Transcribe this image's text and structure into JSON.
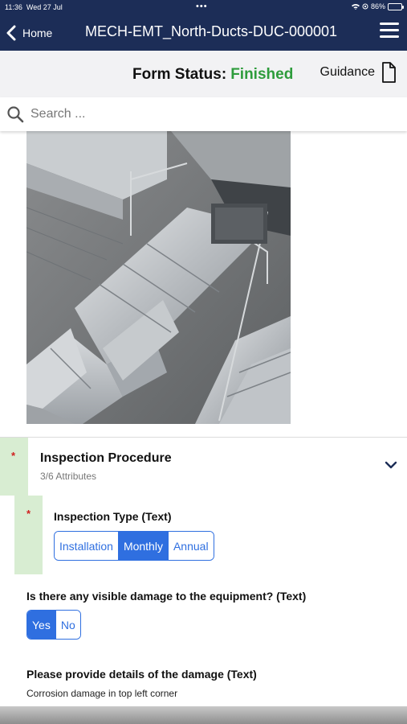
{
  "status_bar": {
    "time": "11:36",
    "date": "Wed 27 Jul",
    "dots": "•••",
    "battery_pct": "86%",
    "battery_level": 0.86
  },
  "nav": {
    "back_label": "Home",
    "title": "MECH-EMT_North-Ducts-DUC-000001"
  },
  "form_status": {
    "label": "Form Status:",
    "value": "Finished",
    "value_color": "#2e9c3c",
    "guidance_label": "Guidance"
  },
  "search": {
    "placeholder": "Search ..."
  },
  "section": {
    "title": "Inspection Procedure",
    "subtitle": "3/6 Attributes",
    "required_mark": "*"
  },
  "fields": [
    {
      "label": "Inspection Type (Text)",
      "required_mark": "*",
      "options": [
        "Installation",
        "Monthly",
        "Annual"
      ],
      "selected": "Monthly"
    },
    {
      "label": "Is there any visible damage to the equipment? (Text)",
      "options": [
        "Yes",
        "No"
      ],
      "selected": "Yes"
    },
    {
      "label": "Please provide details of the damage (Text)",
      "value": "Corrosion damage in top left corner"
    }
  ],
  "colors": {
    "nav_bg": "#1c2d57",
    "accent": "#2f6fe0",
    "required": "#d01f1f",
    "required_highlight": "#d8edd2"
  }
}
